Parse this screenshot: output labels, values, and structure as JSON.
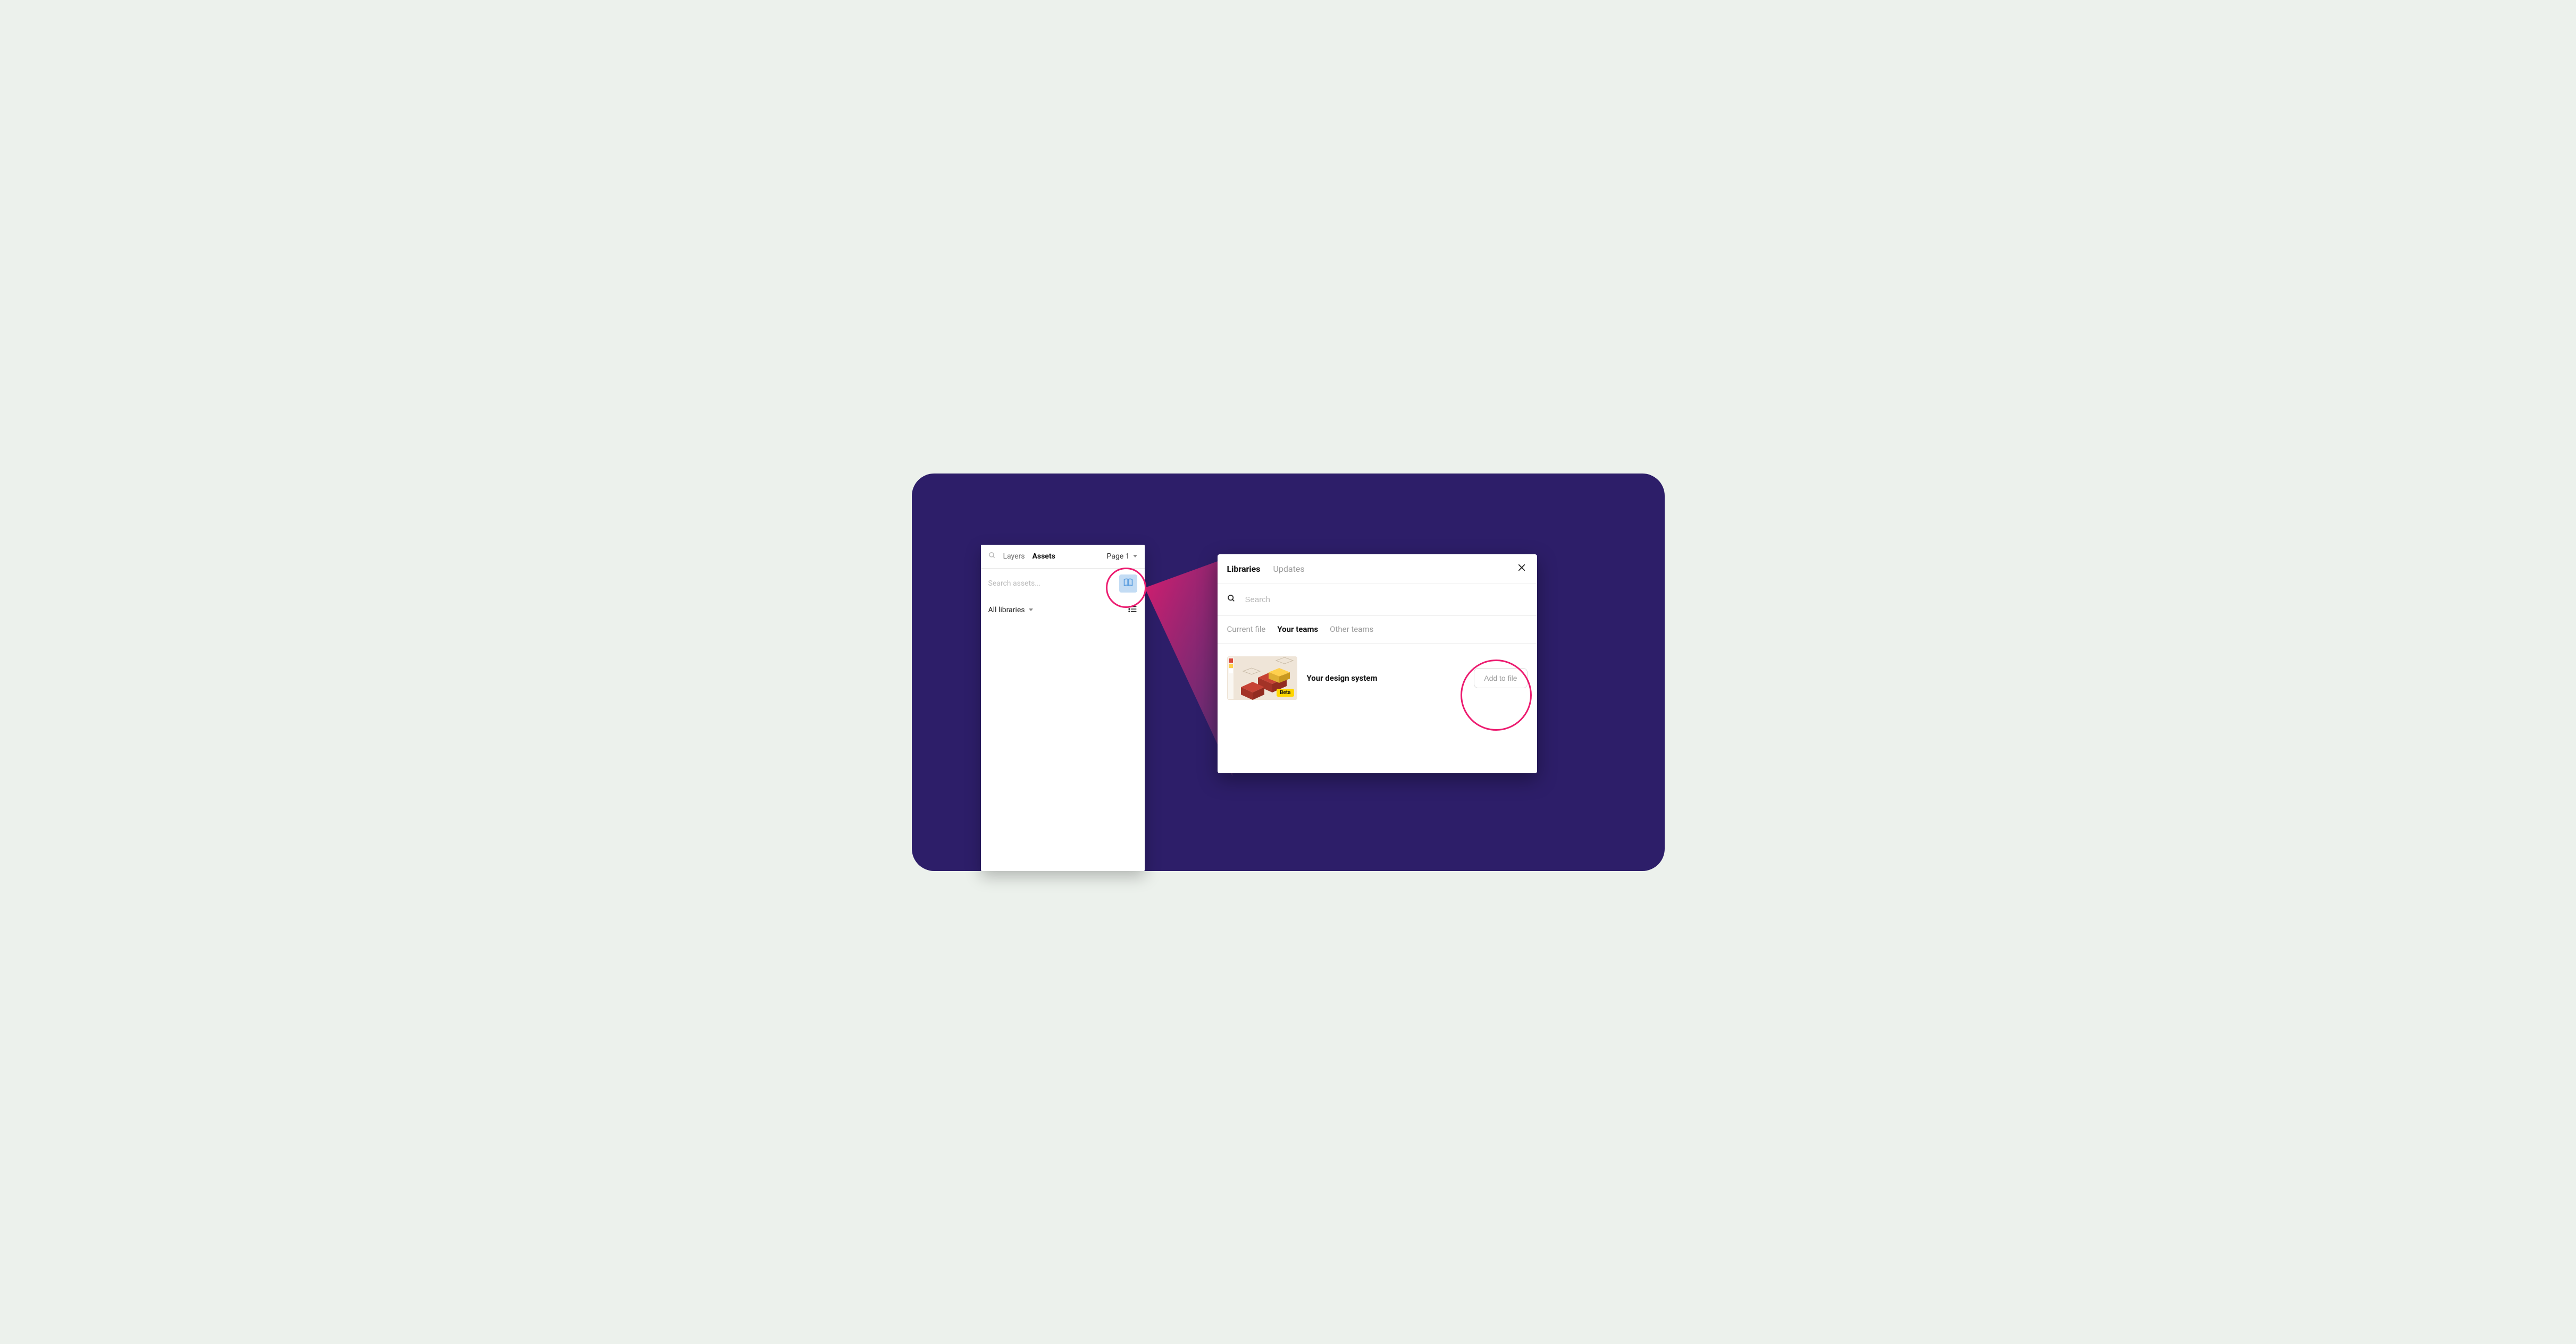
{
  "colors": {
    "stage_bg": "#2d1e69",
    "highlight": "#ec1c70",
    "book_btn_bg": "#c3dcf4",
    "badge_bg": "#ffd600"
  },
  "sidebar": {
    "tabs": {
      "layers": "Layers",
      "assets": "Assets"
    },
    "page_selector": "Page 1",
    "search_placeholder": "Search assets...",
    "filter_label": "All libraries"
  },
  "modal": {
    "tabs": {
      "libraries": "Libraries",
      "updates": "Updates"
    },
    "search_placeholder": "Search",
    "filters": {
      "current_file": "Current file",
      "your_teams": "Your teams",
      "other_teams": "Other teams"
    },
    "library": {
      "name": "Your design system",
      "badge": "Beta",
      "action": "Add to file"
    }
  }
}
